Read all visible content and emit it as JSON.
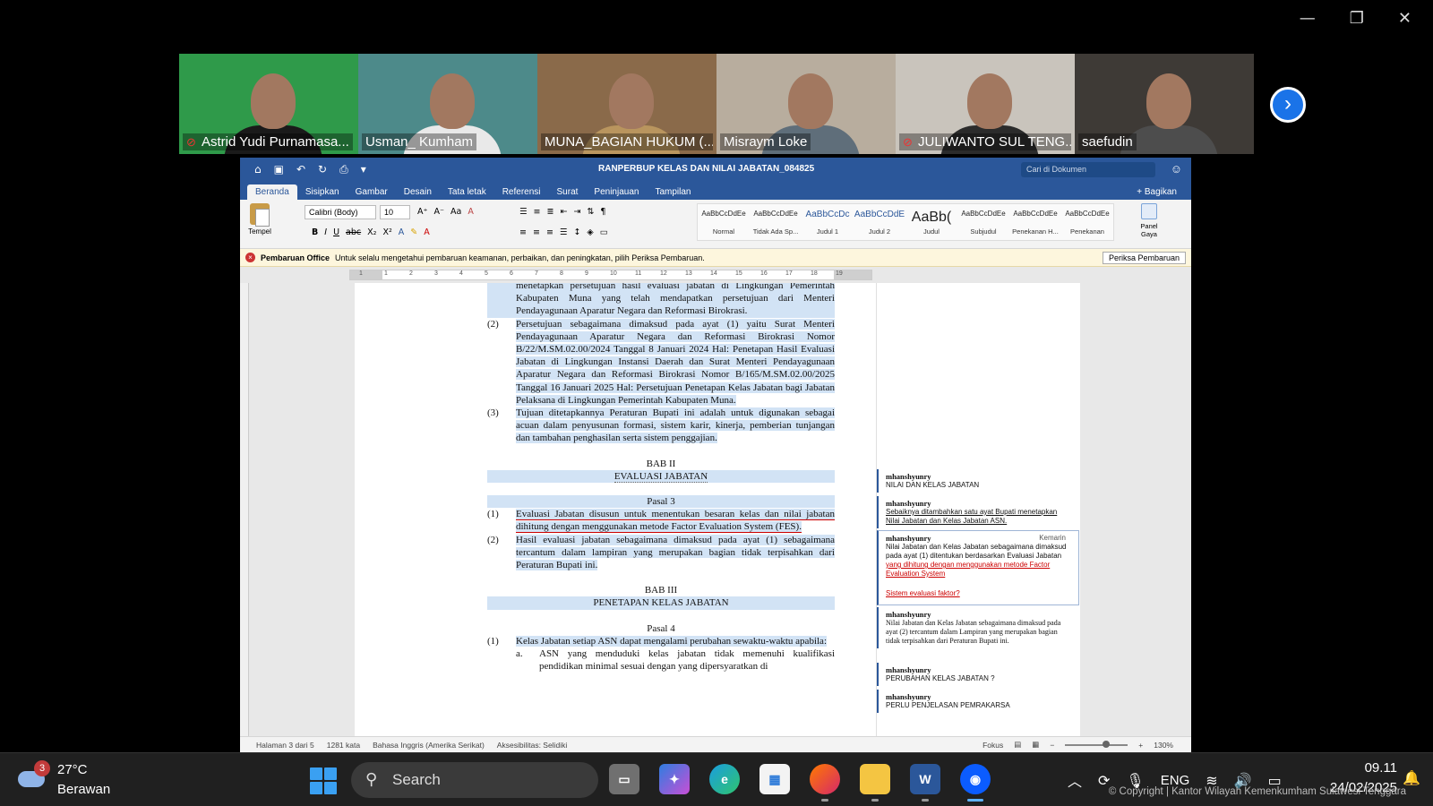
{
  "window_controls": {
    "minimize": "—",
    "restore": "❐",
    "close": "✕"
  },
  "participants": [
    {
      "name": "Astrid Yudi Purnamasa...",
      "muted": true,
      "bg": "#2f9a4a",
      "shirt": "#1a1a1a"
    },
    {
      "name": "Usman_ Kumham",
      "muted": false,
      "bg": "#4d8a8a",
      "shirt": "#e9e9e9"
    },
    {
      "name": "MUNA_BAGIAN HUKUM (...",
      "muted": false,
      "bg": "#8a6a4a",
      "shirt": "#b9955e"
    },
    {
      "name": "Misraym Loke",
      "muted": false,
      "bg": "#b8ad9e",
      "shirt": "#5f6e7a",
      "active": true
    },
    {
      "name": "JULIWANTO SUL TENG...",
      "muted": true,
      "bg": "#c9c4bc",
      "shirt": "#2b2b2b"
    },
    {
      "name": "saefudin",
      "muted": false,
      "bg": "#3e3a36",
      "shirt": "#4d4d4d"
    }
  ],
  "word": {
    "title": "RANPERBUP KELAS DAN NILAI JABATAN_084825",
    "search_placeholder": "Cari di Dokumen",
    "tabs": [
      "Beranda",
      "Sisipkan",
      "Gambar",
      "Desain",
      "Tata letak",
      "Referensi",
      "Surat",
      "Peninjauan",
      "Tampilan"
    ],
    "share": "Bagikan",
    "paste_label": "Tempel",
    "font_name": "Calibri (Body)",
    "font_size": "10",
    "styles": [
      {
        "preview": "AaBbCcDdEe",
        "label": "Normal"
      },
      {
        "preview": "AaBbCcDdEe",
        "label": "Tidak Ada Sp..."
      },
      {
        "preview": "AaBbCcDc",
        "label": "Judul 1"
      },
      {
        "preview": "AaBbCcDdE",
        "label": "Judul 2"
      },
      {
        "preview": "AaBb(",
        "label": "Judul"
      },
      {
        "preview": "AaBbCcDdEe",
        "label": "Subjudul"
      },
      {
        "preview": "AaBbCcDdEe",
        "label": "Penekanan H..."
      },
      {
        "preview": "AaBbCcDdEe",
        "label": "Penekanan"
      }
    ],
    "panel_gaya": "Panel Gaya",
    "notification": {
      "title": "Pembaruan Office",
      "message": "Untuk selalu mengetahui pembaruan keamanan, perbaikan, dan peningkatan, pilih Periksa Pembaruan.",
      "button": "Periksa Pembaruan"
    },
    "ruler_numbers": [
      "1",
      "1",
      "2",
      "3",
      "4",
      "5",
      "6",
      "7",
      "8",
      "9",
      "10",
      "11",
      "12",
      "13",
      "14",
      "15",
      "16",
      "17",
      "18",
      "19"
    ],
    "document": {
      "p_cont": "menetapkan persetujuan hasil evaluasi jabatan di Lingkungan Pemerintah Kabupaten Muna yang telah mendapatkan persetujuan dari Menteri Pendayagunaan Aparatur Negara dan Reformasi Birokrasi.",
      "p2_num": "(2)",
      "p2": "Persetujuan sebagaimana dimaksud pada ayat (1) yaitu Surat Menteri Pendayagunaan Aparatur Negara dan Reformasi Birokrasi Nomor B/22/M.SM.02.00/2024 Tanggal 8 Januari 2024 Hal: Penetapan Hasil Evaluasi Jabatan di Lingkungan Instansi Daerah dan Surat Menteri Pendayagunaan Aparatur Negara dan Reformasi Birokrasi Nomor B/165/M.SM.02.00/2025 Tanggal 16 Januari 2025 Hal: Persetujuan Penetapan Kelas Jabatan bagi Jabatan Pelaksana di Lingkungan Pemerintah Kabupaten Muna.",
      "p3_num": "(3)",
      "p3": "Tujuan ditetapkannya Peraturan Bupati ini adalah untuk digunakan sebagai acuan dalam penyusunan formasi, sistem karir, kinerja, pemberian tunjangan dan tambahan penghasilan serta sistem penggajian.",
      "bab2": "BAB II",
      "bab2_title": "EVALUASI JABATAN",
      "pasal3": "Pasal 3",
      "p31_num": "(1)",
      "p31": "Evaluasi Jabatan disusun untuk menentukan besaran kelas dan nilai jabatan dihitung dengan menggunakan metode Factor Evaluation System (FES).",
      "p32_num": "(2)",
      "p32": "Hasil evaluasi jabatan sebagaimana dimaksud pada ayat (1) sebagaimana tercantum dalam lampiran yang merupakan bagian tidak terpisahkan dari Peraturan Bupati ini.",
      "bab3": "BAB III",
      "bab3_title": "PENETAPAN KELAS JABATAN",
      "pasal4": "Pasal 4",
      "p41_num": "(1)",
      "p41": "Kelas Jabatan setiap ASN dapat mengalami perubahan sewaktu-waktu apabila:",
      "p41a_num": "a.",
      "p41a": "ASN yang menduduki kelas jabatan tidak memenuhi kualifikasi pendidikan minimal sesuai dengan yang dipersyaratkan di"
    },
    "comments": [
      {
        "author": "mhanshyunry",
        "text": "NILAI DAN KELAS JABATAN"
      },
      {
        "author": "mhanshyunry",
        "text": "Sebaiknya ditambahkan satu ayat Bupati menetapkan Nilai Jabatan dan Kelas Jabatan ASN."
      },
      {
        "author": "mhanshyunry",
        "date": "Kemarin",
        "text": "Nilai Jabatan dan Kelas Jabatan sebagaimana dimaksud pada ayat (1) ditentukan berdasarkan Evaluasi Jabatan",
        "red": "yang dihitung dengan menggunakan metode Factor Evaluation System",
        "reply": "Sistem evaluasi faktor?"
      },
      {
        "author": "mhanshyunry",
        "text": "Nilai Jabatan dan Kelas Jabatan sebagaimana dimaksud pada ayat (2) tercantum dalam Lampiran yang merupakan bagian tidak terpisahkan dari Peraturan Bupati ini."
      },
      {
        "author": "mhanshyunry",
        "text": "PERUBAHAN KELAS JABATAN ?"
      },
      {
        "author": "mhanshyunry",
        "text": "PERLU PENJELASAN PEMRAKARSA"
      }
    ],
    "status": {
      "page": "Halaman 3 dari 5",
      "words": "1281 kata",
      "language": "Bahasa Inggris (Amerika Serikat)",
      "accessibility": "Aksesibilitas: Selidiki",
      "focus": "Fokus",
      "zoom": "130%"
    }
  },
  "taskbar": {
    "weather_badge": "3",
    "temperature": "27°C",
    "condition": "Berawan",
    "search": "Search",
    "lang": "ENG",
    "time": "09.11",
    "date": "24/02/2025"
  },
  "watermark": "© Copyright | Kantor Wilayah Kemenkumham Sulawesi Tenggara"
}
